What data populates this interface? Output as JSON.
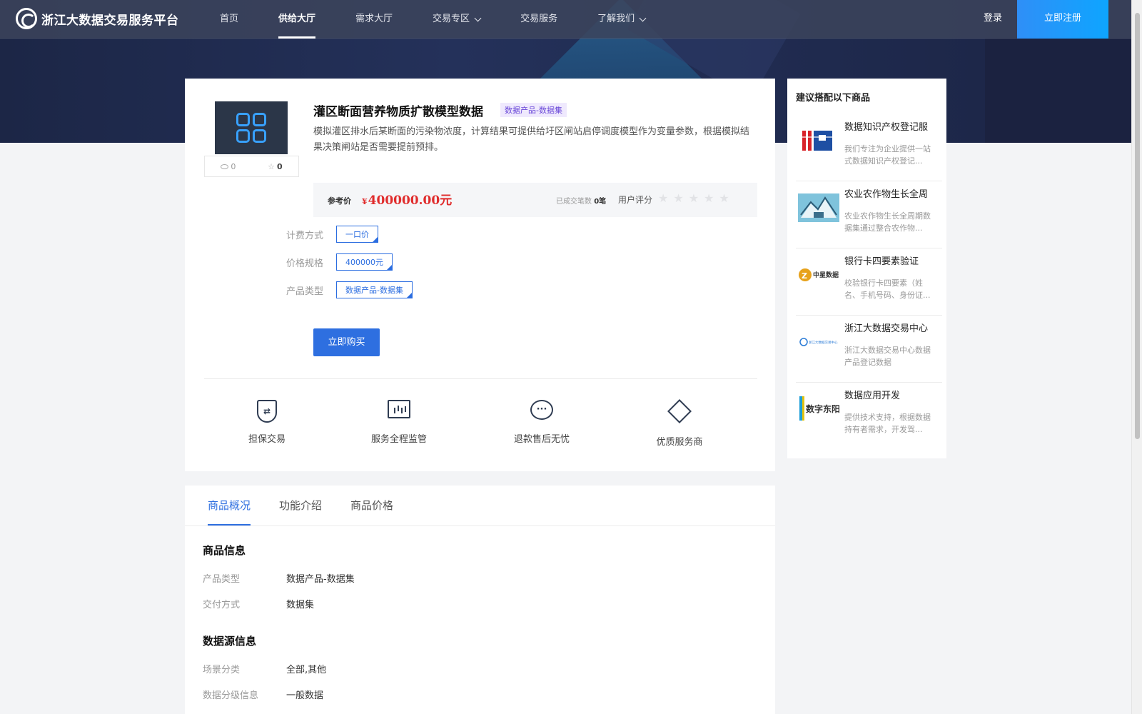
{
  "header": {
    "logo_text": "浙江大数据交易服务平台",
    "nav": [
      {
        "label": "首页"
      },
      {
        "label": "供给大厅"
      },
      {
        "label": "需求大厅"
      },
      {
        "label": "交易专区"
      },
      {
        "label": "交易服务"
      },
      {
        "label": "了解我们"
      }
    ],
    "login": "登录",
    "register": "立即注册"
  },
  "product": {
    "title": "灌区断面营养物质扩散模型数据",
    "tag": "数据产品-数据集",
    "description": "模拟灌区排水后某断面的污染物浓度，计算结果可提供给圩区闸站启停调度模型作为变量参数，根据模拟结果决策闸站是否需要提前预排。",
    "views": "0",
    "favorites": "0",
    "price_label": "参考价",
    "price_currency": "¥",
    "price": "400000.00元",
    "deals_label": "已成交笔数",
    "deals_value": "0笔",
    "rating_label": "用户评分",
    "rating_stars": "★★★★★",
    "rating_value": 0,
    "options": {
      "billing_label": "计费方式",
      "billing_value": "一口价",
      "spec_label": "价格规格",
      "spec_value": "400000元",
      "type_label": "产品类型",
      "type_value": "数据产品-数据集"
    },
    "buy_button": "立即购买",
    "services": [
      {
        "label": "担保交易",
        "icon": "shield-swap-icon"
      },
      {
        "label": "服务全程监管",
        "icon": "monitor-chart-icon"
      },
      {
        "label": "退款售后无忧",
        "icon": "chat-bubble-icon"
      },
      {
        "label": "优质服务商",
        "icon": "diamond-icon"
      }
    ]
  },
  "recommendations": {
    "title": "建议搭配以下商品",
    "items": [
      {
        "name": "数据知识产权登记服",
        "desc": "我们专注为企业提供一站式数据知识产权登记...",
        "thumb_text": "iiR"
      },
      {
        "name": "农业农作物生长全周",
        "desc": "农业农作物生长全周期数据集通过整合农作物...",
        "thumb_text": ""
      },
      {
        "name": "银行卡四要素验证",
        "desc": "校验银行卡四要素（姓名、手机号码、身份证...",
        "thumb_text": "中星数据"
      },
      {
        "name": "浙江大数据交易中心",
        "desc": "浙江大数据交易中心数据产品登记数据",
        "thumb_text": "浙江大数据交易中心"
      },
      {
        "name": "数据应用开发",
        "desc": "提供技术支持，根据数据持有者需求，开发驾...",
        "thumb_text": "数字东阳"
      }
    ]
  },
  "details": {
    "tabs": [
      {
        "label": "商品概况"
      },
      {
        "label": "功能介绍"
      },
      {
        "label": "商品价格"
      }
    ],
    "section1_title": "商品信息",
    "product_type_label": "产品类型",
    "product_type_value": "数据产品-数据集",
    "delivery_label": "交付方式",
    "delivery_value": "数据集",
    "section2_title": "数据源信息",
    "scene_label": "场景分类",
    "scene_value": "全部,其他",
    "grade_label": "数据分级信息",
    "grade_value": "一般数据"
  },
  "colors": {
    "accent": "#2e6fe0",
    "price": "#e02c2c",
    "tag_text": "#6a48d8",
    "nav_bg": "#3c445c"
  }
}
